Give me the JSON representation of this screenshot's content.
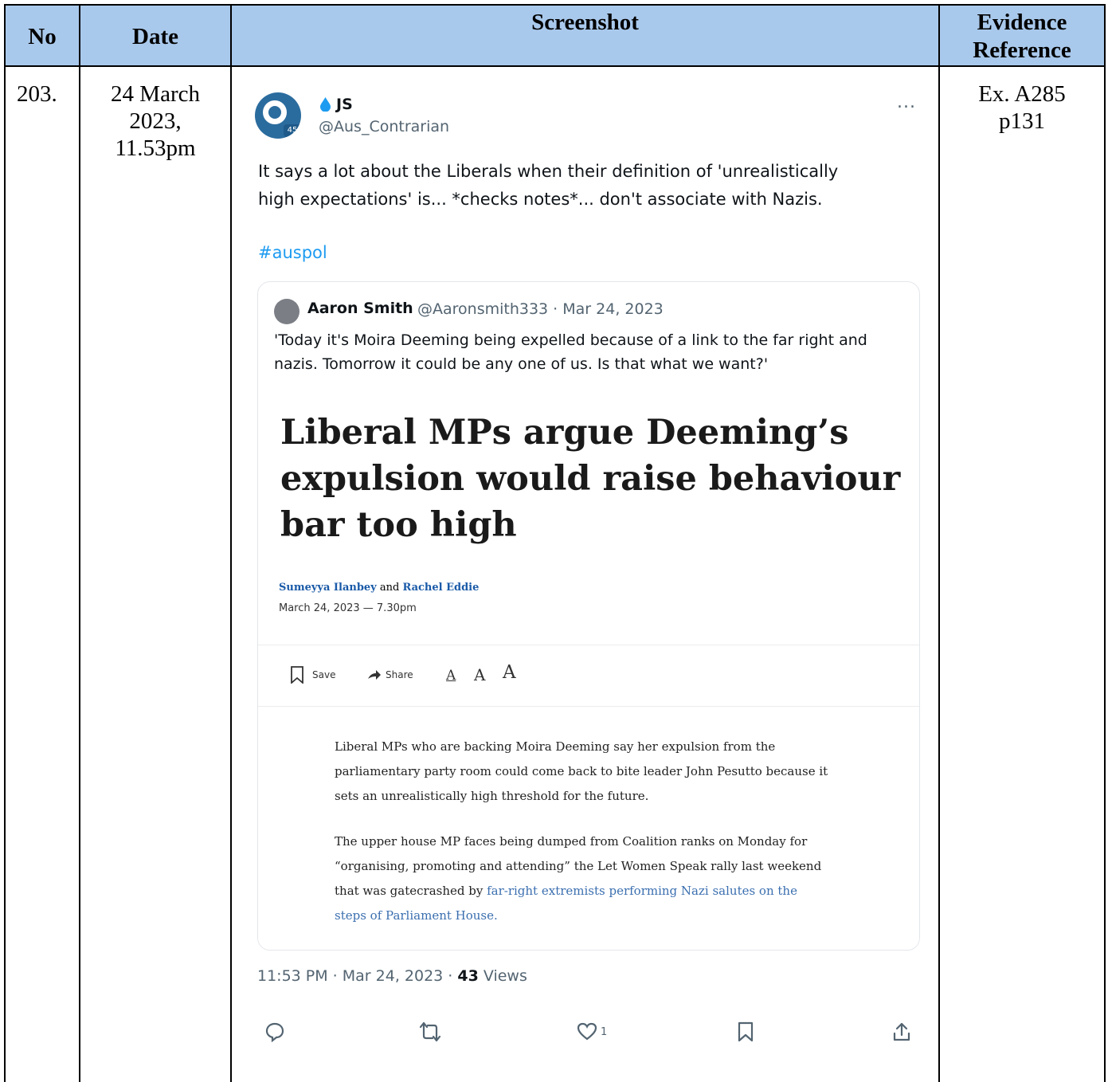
{
  "table": {
    "headers": {
      "no": "No",
      "date": "Date",
      "screenshot": "Screenshot",
      "evidence_line1": "Evidence",
      "evidence_line2": "Reference"
    },
    "row": {
      "no": "203.",
      "date_line1": "24 March",
      "date_line2": "2023,",
      "date_line3": "11.53pm",
      "evidence_line1": "Ex. A285",
      "evidence_line2": "p131"
    }
  },
  "tweet": {
    "display_name": "JS",
    "handle": "@Aus_Contrarian",
    "avatar_badge": "45",
    "more_label": "...",
    "text_line1": "It says a lot about the Liberals when their definition of 'unrealistically",
    "text_line2": "high expectations' is... *checks notes*...  don't associate with Nazis.",
    "hashtag": "#auspol",
    "quote": {
      "name": "Aaron Smith",
      "meta": "@Aaronsmith333 · Mar 24, 2023",
      "text_line1": "'Today it's Moira Deeming being expelled because of a link to the far right and",
      "text_line2": "nazis. Tomorrow it could be any one of us. Is that what we want?'",
      "article": {
        "headline_line1": "Liberal MPs argue Deeming’s",
        "headline_line2": "expulsion would raise behaviour",
        "headline_line3": "bar too high",
        "author1": "Sumeyya Ilanbey",
        "and": "and",
        "author2": "Rachel Eddie",
        "date": "March 24, 2023 — 7.30pm",
        "save_label": "Save",
        "share_label": "Share",
        "font_small": "A",
        "font_medium": "A",
        "font_large": "A",
        "p1_line1": "Liberal MPs who are backing Moira Deeming say her expulsion from the",
        "p1_line2": "parliamentary party room could come back to bite leader John Pesutto because it",
        "p1_line3": "sets an unrealistically high threshold for the future.",
        "p2_line1": "The upper house MP faces being dumped from Coalition ranks on Monday for",
        "p2_line2": "“organising, promoting and attending” the Let Women Speak rally last weekend",
        "p2_line3_plain": "that was gatecrashed by ",
        "p2_line3_link": "far-right extremists performing Nazi salutes on the",
        "p2_line4_link": "steps of Parliament House."
      }
    },
    "timestamp": "11:53 PM · Mar 24, 2023 · ",
    "views_count": "43",
    "views_label": " Views",
    "likes_count": "1"
  },
  "colors": {
    "header_bg": "#a9c9ec",
    "link_blue": "#1d9bf0",
    "author_blue": "#1a5aa8"
  }
}
